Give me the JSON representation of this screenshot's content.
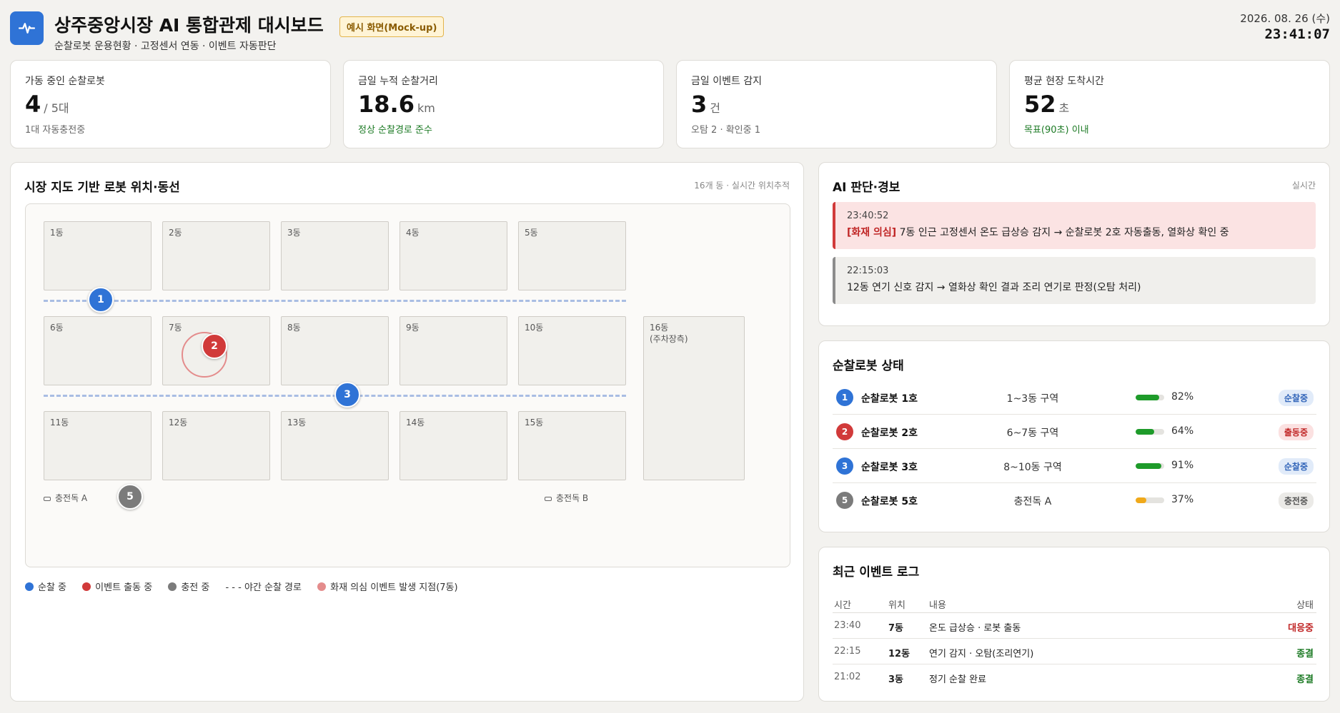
{
  "header": {
    "title": "상주중앙시장 AI 통합관제 대시보드",
    "subtitle": "순찰로봇 운용현황 · 고정센서 연동 · 이벤트 자동판단",
    "badge": "예시 화면(Mock-up)",
    "date": "2026. 08. 26 (수)",
    "time": "23:41:07",
    "icon": "pulse-icon",
    "accent": "#2f73d6"
  },
  "kpis": [
    {
      "label": "가동 중인 순찰로봇",
      "value": "4",
      "unit": "/ 5대",
      "note": "1대 자동충전중",
      "note_color": "gray"
    },
    {
      "label": "금일 누적 순찰거리",
      "value": "18.6",
      "unit": "km",
      "note": "정상 순찰경로 준수",
      "note_color": "green"
    },
    {
      "label": "금일 이벤트 감지",
      "value": "3",
      "unit": "건",
      "note": "오탐 2 · 확인중 1",
      "note_color": "gray"
    },
    {
      "label": "평균 현장 도착시간",
      "value": "52",
      "unit": "초",
      "note": "목표(90초) 이내",
      "note_color": "green"
    }
  ],
  "map": {
    "title": "시장 지도 기반 로봇 위치·동선",
    "meta": "16개 동 · 실시간 위치추적",
    "stalls": [
      "1동",
      "2동",
      "3동",
      "4동",
      "5동",
      "6동",
      "7동",
      "8동",
      "9동",
      "10동",
      "11동",
      "12동",
      "13동",
      "14동",
      "15동",
      "16동\n(주차장측)"
    ],
    "robots": [
      "1",
      "2",
      "3",
      "5"
    ],
    "docks": [
      "충전독 A",
      "충전독 B"
    ],
    "legend": [
      {
        "label": "순찰 중",
        "color": "#2f73d6"
      },
      {
        "label": "이벤트 출동 중",
        "color": "#d13a3a"
      },
      {
        "label": "충전 중",
        "color": "#7b7b7b"
      },
      {
        "label": "- - - 야간 순찰 경로"
      },
      {
        "label": "화재 의심 이벤트 발생 지점(7동)",
        "color": "#e48c8c"
      }
    ]
  },
  "alerts": {
    "title": "AI 판단·경보",
    "meta": "실시간",
    "items": [
      {
        "time": "23:40:52",
        "tag": "[화재 의심]",
        "text": " 7동 인근 고정센서 온도 급상승 감지 → 순찰로봇 2호 자동출동, 열화상 확인 중"
      },
      {
        "time": "22:15:03",
        "tag": "",
        "text": "12동 연기 신호 감지 → 열화상 확인 결과 조리 연기로 판정(오탐 처리)"
      }
    ]
  },
  "robot_status": {
    "title": "순찰로봇 상태",
    "items": [
      {
        "id": "1",
        "name": "순찰로봇 1호",
        "zone": "1~3동 구역",
        "battery": 82,
        "battery_label": "82%",
        "status": "순찰중"
      },
      {
        "id": "2",
        "name": "순찰로봇 2호",
        "zone": "6~7동 구역",
        "battery": 64,
        "battery_label": "64%",
        "status": "출동중"
      },
      {
        "id": "3",
        "name": "순찰로봇 3호",
        "zone": "8~10동 구역",
        "battery": 91,
        "battery_label": "91%",
        "status": "순찰중"
      },
      {
        "id": "5",
        "name": "순찰로봇 5호",
        "zone": "충전독 A",
        "battery": 37,
        "battery_label": "37%",
        "status": "충전중"
      }
    ]
  },
  "event_log": {
    "title": "최근 이벤트 로그",
    "columns": [
      "시간",
      "위치",
      "내용",
      "상태"
    ],
    "rows": [
      {
        "time": "23:40",
        "loc": "7동",
        "text": "온도 급상승 · 로봇 출동",
        "status": "대응중"
      },
      {
        "time": "22:15",
        "loc": "12동",
        "text": "연기 감지 · 오탐(조리연기)",
        "status": "종결"
      },
      {
        "time": "21:02",
        "loc": "3동",
        "text": "정기 순찰 완료",
        "status": "종결"
      }
    ]
  }
}
